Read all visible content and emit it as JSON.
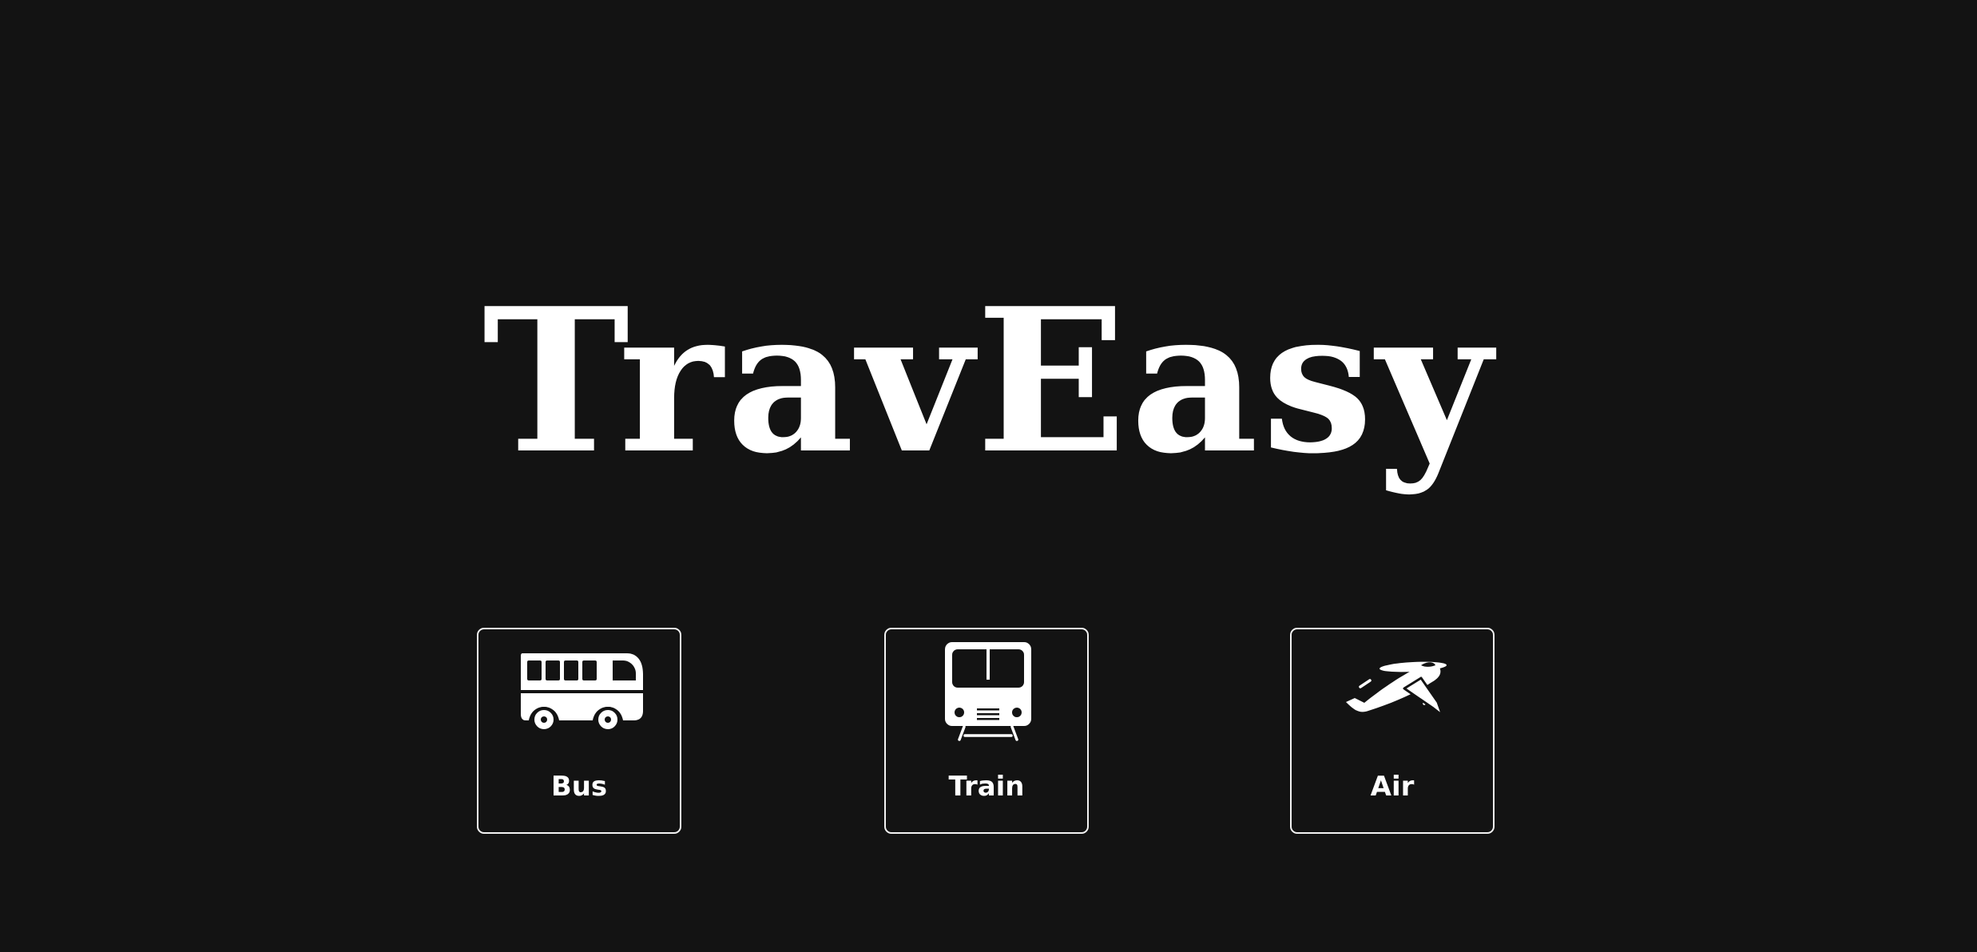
{
  "app": {
    "title": "TravEasy"
  },
  "colors": {
    "background": "#131313",
    "foreground": "#ffffff",
    "card_border": "#f2f2f2"
  },
  "modes": [
    {
      "label": "Bus",
      "icon": "bus-icon"
    },
    {
      "label": "Train",
      "icon": "train-icon"
    },
    {
      "label": "Air",
      "icon": "airplane-icon"
    }
  ]
}
